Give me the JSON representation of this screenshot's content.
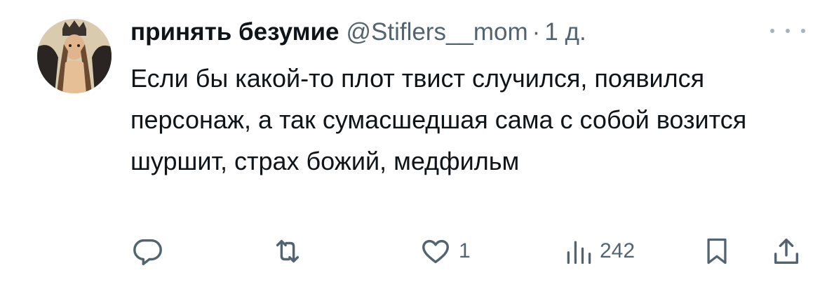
{
  "tweet": {
    "display_name": "принять безумие",
    "handle": "@Stiflers__mom",
    "separator": "·",
    "time": "1 д.",
    "text": "Если бы какой-то плот твист случился, появился персонаж, а так сумасшедшая сама с собой возится шуршит, страх божий, медфильм"
  },
  "actions": {
    "reply_icon": "reply-icon",
    "retweet_icon": "retweet-icon",
    "like_icon": "heart-icon",
    "like_count": "1",
    "views_icon": "views-icon",
    "views_count": "242",
    "bookmark_icon": "bookmark-icon",
    "share_icon": "share-icon"
  },
  "colors": {
    "text": "#0f1419",
    "muted": "#536471"
  }
}
